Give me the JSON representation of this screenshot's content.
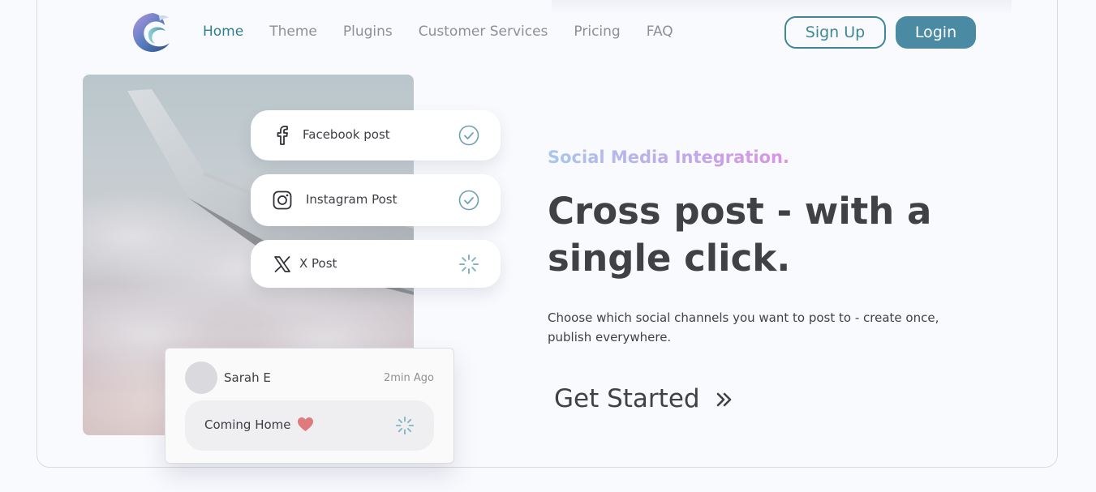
{
  "nav": {
    "links": [
      "Home",
      "Theme",
      "Plugins",
      "Customer Services",
      "Pricing",
      "FAQ"
    ],
    "active": "Home",
    "signup_label": "Sign Up",
    "login_label": "Login"
  },
  "posts": [
    {
      "label": "Facebook post",
      "icon": "facebook-icon",
      "status": "done"
    },
    {
      "label": "Instagram Post",
      "icon": "instagram-icon",
      "status": "done"
    },
    {
      "label": "X Post",
      "icon": "x-icon",
      "status": "loading"
    }
  ],
  "comment": {
    "name": "Sarah E",
    "time": "2min Ago",
    "text": "Coming Home"
  },
  "hero": {
    "eyebrow": "Social Media Integration.",
    "headline": "Cross post - with a single click.",
    "description": "Choose which social channels you want to post to - create once, publish everywhere.",
    "cta": "Get Started",
    "cta_icon": "double-chevron-right-icon"
  },
  "colors": {
    "accent": "#4a8aa3",
    "nav_active": "#2e7f8d",
    "check": "#6aa3b3",
    "heart": "#e07a7c"
  }
}
